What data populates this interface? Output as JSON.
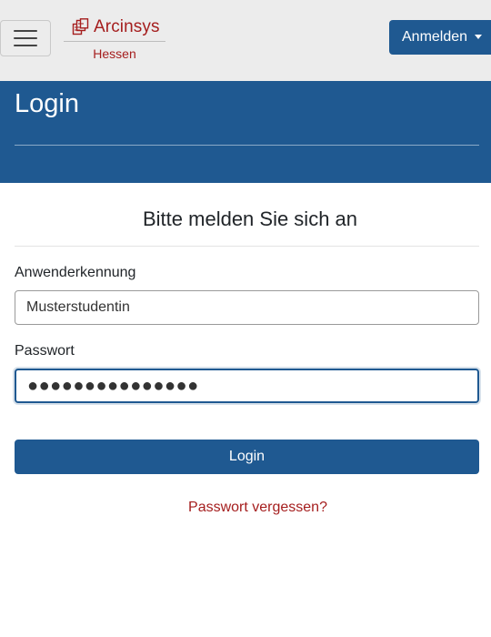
{
  "navbar": {
    "menu_icon": "hamburger-menu-icon",
    "brand": {
      "icon": "documents-icon",
      "name": "Arcinsys",
      "subtitle": "Hessen"
    },
    "login_dropdown_label": "Anmelden"
  },
  "hero": {
    "title": "Login"
  },
  "form": {
    "heading": "Bitte melden Sie sich an",
    "username": {
      "label": "Anwenderkennung",
      "value": "Musterstudentin"
    },
    "password": {
      "label": "Passwort",
      "masked_value": "●●●●●●●●●●●●●●●"
    },
    "submit_label": "Login",
    "forgot_label": "Passwort vergessen?"
  },
  "colors": {
    "brand_red": "#a51e1e",
    "primary_blue": "#1f5991",
    "navbar_bg": "#ececec"
  }
}
